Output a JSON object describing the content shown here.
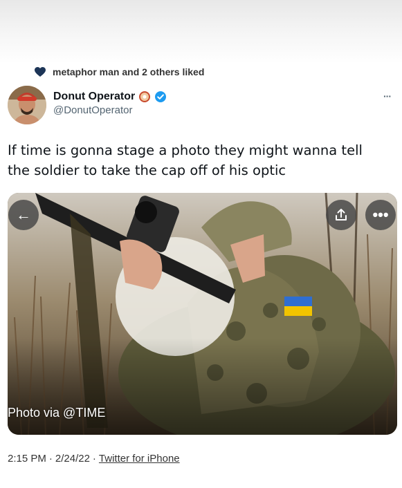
{
  "liked": {
    "text": "metaphor man and 2 others liked",
    "icon": "heart-icon",
    "icon_color": "#1d3557"
  },
  "author": {
    "name": "Donut Operator",
    "handle": "@DonutOperator",
    "verified_color": "#1d9bf0",
    "more_label": "···"
  },
  "tweet": {
    "text": "If time is gonna stage a photo they might wanna tell the soldier to take the cap off of his optic"
  },
  "media": {
    "caption": "Photo via @TIME",
    "back_label": "←",
    "share_icon": "share-icon",
    "more_label": "•••"
  },
  "meta": {
    "time": "2:15 PM",
    "sep1": "·",
    "date": "2/24/22",
    "sep2": "·",
    "source": "Twitter for iPhone"
  }
}
